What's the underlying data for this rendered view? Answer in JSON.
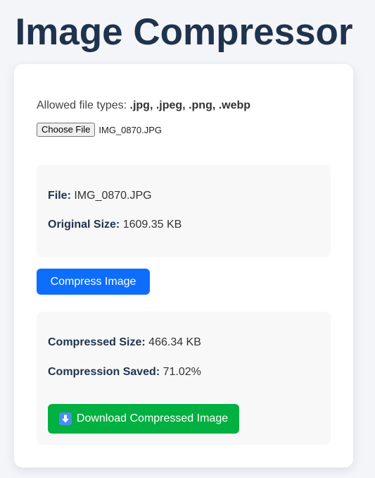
{
  "page": {
    "title": "Image Compressor"
  },
  "upload": {
    "allowed_label": "Allowed file types:",
    "allowed_types": ".jpg, .jpeg, .png, .webp",
    "choose_button": "Choose File",
    "selected_file": "IMG_0870.JPG"
  },
  "original": {
    "file_label": "File:",
    "file_value": "IMG_0870.JPG",
    "size_label": "Original Size:",
    "size_value": "1609.35 KB"
  },
  "actions": {
    "compress_label": "Compress Image"
  },
  "result": {
    "compressed_label": "Compressed Size:",
    "compressed_value": "466.34 KB",
    "saved_label": "Compression Saved:",
    "saved_value": "71.02%",
    "download_label": "Download Compressed Image",
    "download_icon": "down-arrow-emoji-icon"
  },
  "colors": {
    "title": "#1f334d",
    "primary_button": "#0d6efd",
    "download_button": "#00b040",
    "background": "#f4f5f9"
  }
}
